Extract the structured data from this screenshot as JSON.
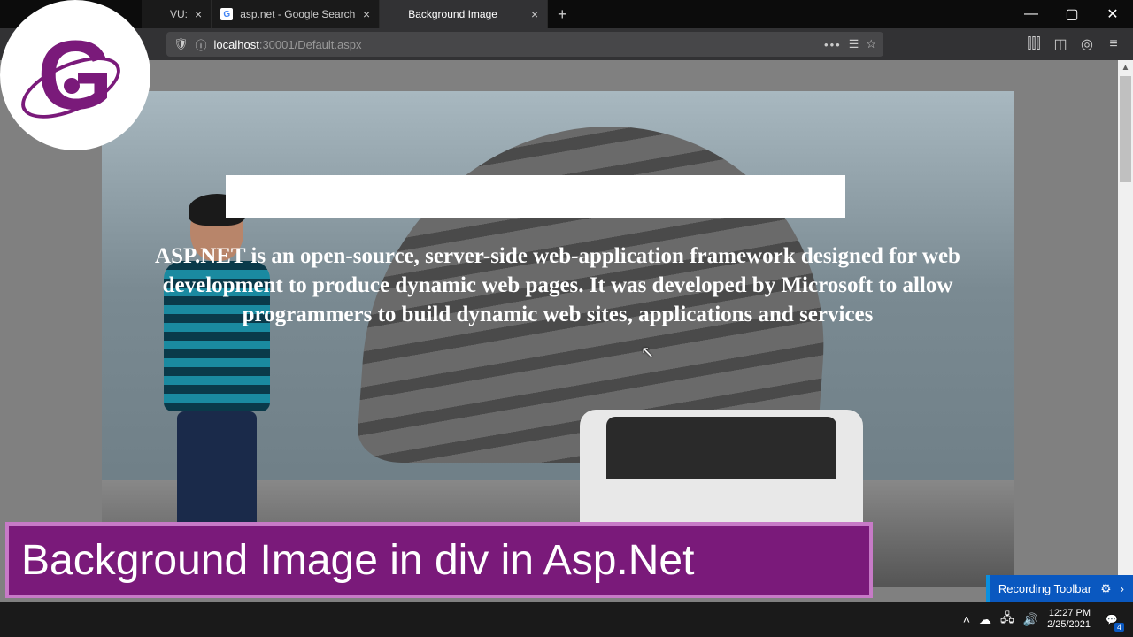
{
  "titlebar": {
    "tabs": [
      {
        "favicon": "",
        "label": "VU:",
        "active": false
      },
      {
        "favicon": "G",
        "label": "asp.net - Google Search",
        "active": false
      },
      {
        "favicon": "",
        "label": "Background Image",
        "active": true
      }
    ]
  },
  "navbar": {
    "url_host": "localhost",
    "url_path": ":30001/Default.aspx"
  },
  "page": {
    "description": "ASP.NET is an open-source, server-side web-application framework designed for web development to produce dynamic web pages. It was developed by Microsoft to allow programmers to build dynamic web sites, applications and services"
  },
  "caption": {
    "text": "Background Image in div in Asp.Net"
  },
  "recording": {
    "label": "Recording Toolbar"
  },
  "tray": {
    "time": "12:27 PM",
    "date": "2/25/2021",
    "notif_count": "4"
  }
}
